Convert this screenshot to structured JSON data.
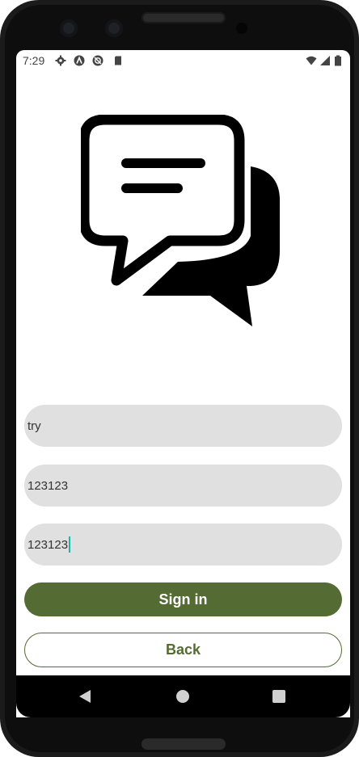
{
  "status_bar": {
    "time": "7:29",
    "icons": [
      "settings-icon",
      "a-icon",
      "sync-icon",
      "sd-card-icon",
      "wifi-icon",
      "signal-icon",
      "battery-icon"
    ]
  },
  "logo": {
    "icon": "chat-bubbles-icon"
  },
  "form": {
    "username_value": "try",
    "password_value": "123123",
    "confirm_value": "123123",
    "caret_color": "#1ab6b0"
  },
  "buttons": {
    "signin_label": "Sign in",
    "back_label": "Back",
    "accent_color": "#546b33"
  },
  "nav": {
    "icons": [
      "back-icon",
      "home-icon",
      "recents-icon"
    ]
  }
}
